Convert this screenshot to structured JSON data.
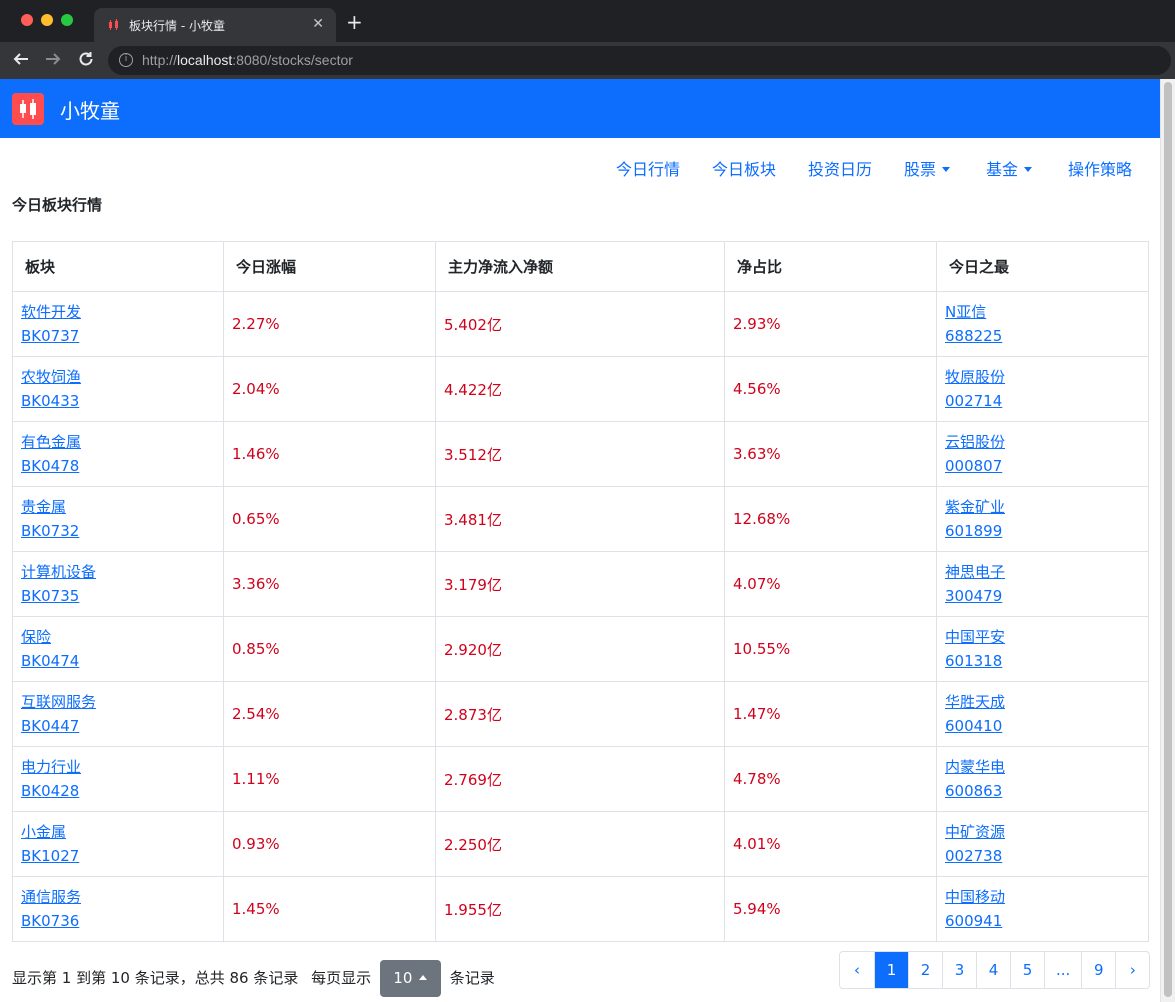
{
  "browser": {
    "tab_title": "板块行情 - 小牧童",
    "url_prefix": "http://",
    "url_host": "localhost",
    "url_path": ":8080/stocks/sector"
  },
  "navbar": {
    "brand": "小牧童"
  },
  "subnav": {
    "items": [
      "今日行情",
      "今日板块",
      "投资日历",
      "股票",
      "基金",
      "操作策略"
    ]
  },
  "page": {
    "title": "今日板块行情"
  },
  "table": {
    "headers": [
      "板块",
      "今日涨幅",
      "主力净流入净额",
      "净占比",
      "今日之最"
    ],
    "rows": [
      {
        "name": "软件开发",
        "code": "BK0737",
        "change": "2.27%",
        "inflow": "5.402亿",
        "ratio": "2.93%",
        "top_name": "N亚信",
        "top_code": "688225"
      },
      {
        "name": "农牧饲渔",
        "code": "BK0433",
        "change": "2.04%",
        "inflow": "4.422亿",
        "ratio": "4.56%",
        "top_name": "牧原股份",
        "top_code": "002714"
      },
      {
        "name": "有色金属",
        "code": "BK0478",
        "change": "1.46%",
        "inflow": "3.512亿",
        "ratio": "3.63%",
        "top_name": "云铝股份",
        "top_code": "000807"
      },
      {
        "name": "贵金属",
        "code": "BK0732",
        "change": "0.65%",
        "inflow": "3.481亿",
        "ratio": "12.68%",
        "top_name": "紫金矿业",
        "top_code": "601899"
      },
      {
        "name": "计算机设备",
        "code": "BK0735",
        "change": "3.36%",
        "inflow": "3.179亿",
        "ratio": "4.07%",
        "top_name": "神思电子",
        "top_code": "300479"
      },
      {
        "name": "保险",
        "code": "BK0474",
        "change": "0.85%",
        "inflow": "2.920亿",
        "ratio": "10.55%",
        "top_name": "中国平安",
        "top_code": "601318"
      },
      {
        "name": "互联网服务",
        "code": "BK0447",
        "change": "2.54%",
        "inflow": "2.873亿",
        "ratio": "1.47%",
        "top_name": "华胜天成",
        "top_code": "600410"
      },
      {
        "name": "电力行业",
        "code": "BK0428",
        "change": "1.11%",
        "inflow": "2.769亿",
        "ratio": "4.78%",
        "top_name": "内蒙华电",
        "top_code": "600863"
      },
      {
        "name": "小金属",
        "code": "BK1027",
        "change": "0.93%",
        "inflow": "2.250亿",
        "ratio": "4.01%",
        "top_name": "中矿资源",
        "top_code": "002738"
      },
      {
        "name": "通信服务",
        "code": "BK0736",
        "change": "1.45%",
        "inflow": "1.955亿",
        "ratio": "5.94%",
        "top_name": "中国移动",
        "top_code": "600941"
      }
    ]
  },
  "footer": {
    "range_text": "显示第 1 到第 10 条记录，总共 86 条记录",
    "per_page_prefix": "每页显示",
    "page_size": "10",
    "per_page_suffix": "条记录"
  },
  "pagination": [
    "‹",
    "1",
    "2",
    "3",
    "4",
    "5",
    "...",
    "9",
    "›"
  ],
  "colors": {
    "primary": "#0d6efd",
    "up": "#d0021b"
  }
}
